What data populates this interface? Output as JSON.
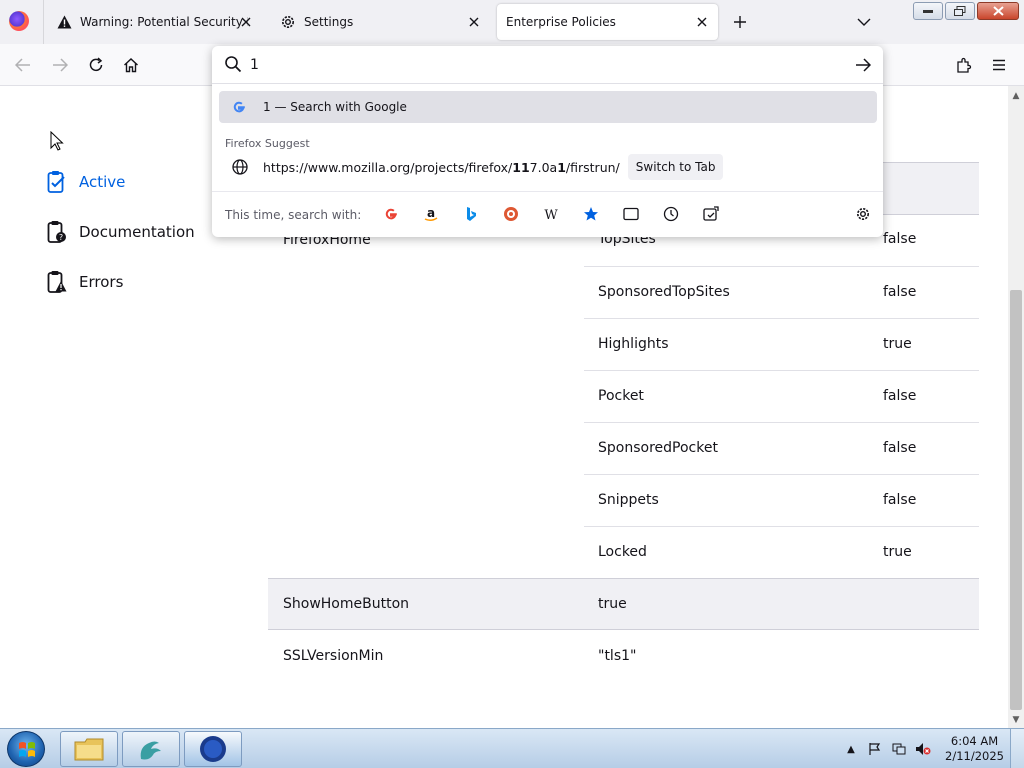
{
  "tabs": [
    {
      "title": "Warning: Potential Security Risk Ahead",
      "icon": "warning-icon"
    },
    {
      "title": "Settings",
      "icon": "gear-icon"
    },
    {
      "title": "Enterprise Policies",
      "icon": "none",
      "active": true
    }
  ],
  "urlbar": {
    "value": "1",
    "google_result_query": "1",
    "google_result_action": " — Search with Google",
    "suggest_heading": "Firefox Suggest",
    "suggest_url_parts": [
      "https://www.mozilla.org/projects/firefox/",
      "11",
      "7.0a",
      "1",
      "/firstrun/"
    ],
    "switch_to_tab": "Switch to Tab",
    "search_with_label": "This time, search with:",
    "oneoff_engines": [
      "google-icon",
      "amazon-icon",
      "bing-icon",
      "duckduckgo-icon",
      "wikipedia-icon",
      "bookmarks-icon",
      "tabs-icon",
      "history-icon",
      "actions-icon"
    ]
  },
  "sidebar": {
    "items": [
      {
        "label": "Active",
        "icon": "clipboard-check-icon",
        "active": true
      },
      {
        "label": "Documentation",
        "icon": "clipboard-question-icon"
      },
      {
        "label": "Errors",
        "icon": "clipboard-warning-icon"
      }
    ]
  },
  "policies": {
    "firefox_home": {
      "name": "FirefoxHome",
      "sub": [
        {
          "key": "TopSites",
          "value": "false"
        },
        {
          "key": "SponsoredTopSites",
          "value": "false"
        },
        {
          "key": "Highlights",
          "value": "true"
        },
        {
          "key": "Pocket",
          "value": "false"
        },
        {
          "key": "SponsoredPocket",
          "value": "false"
        },
        {
          "key": "Snippets",
          "value": "false"
        },
        {
          "key": "Locked",
          "value": "true"
        }
      ]
    },
    "show_home_button": {
      "name": "ShowHomeButton",
      "value": "true"
    },
    "ssl_version_min": {
      "name": "SSLVersionMin",
      "value": "\"tls1\""
    }
  },
  "taskbar": {
    "clock_time": "6:04 AM",
    "clock_date": "2/11/2025"
  },
  "colors": {
    "accent": "#0061e0",
    "row_shade": "#f0f0f4"
  }
}
